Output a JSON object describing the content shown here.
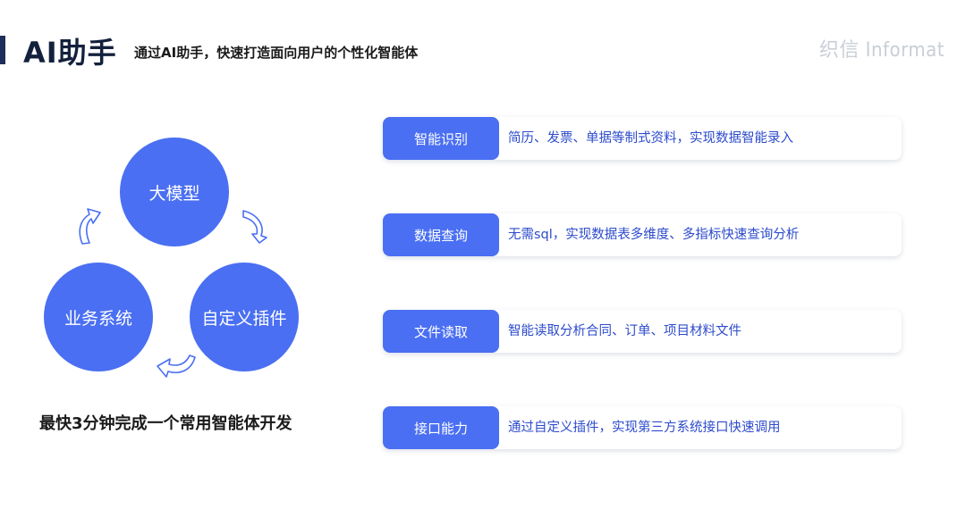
{
  "header": {
    "title": "AI助手",
    "subtitle": "通过AI助手，快速打造面向用户的个性化智能体",
    "logo_text": "织信 Informat"
  },
  "cycle": {
    "nodes": [
      "大模型",
      "业务系统",
      "自定义插件"
    ],
    "tagline": "最快3分钟完成一个常用智能体开发"
  },
  "features": [
    {
      "label": "智能识别",
      "desc": "简历、发票、单据等制式资料，实现数据智能录入"
    },
    {
      "label": "数据查询",
      "desc": "无需sql，实现数据表多维度、多指标快速查询分析"
    },
    {
      "label": "文件读取",
      "desc": "智能读取分析合同、订单、项目材料文件"
    },
    {
      "label": "接口能力",
      "desc": "通过自定义插件，实现第三方系统接口快速调用"
    }
  ],
  "colors": {
    "accent": "#4a6ff2",
    "desc_text": "#2d4bcc",
    "title_bar": "#1f2d5a"
  }
}
